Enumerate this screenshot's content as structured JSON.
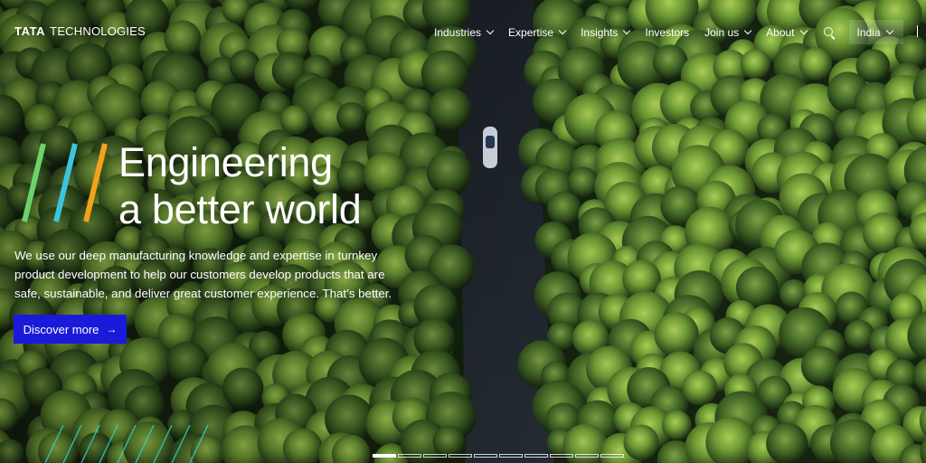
{
  "brand": {
    "name_bold": "TATA",
    "name_rest": "TECHNOLOGIES"
  },
  "nav": {
    "items": [
      {
        "label": "Industries",
        "has_dropdown": true
      },
      {
        "label": "Expertise",
        "has_dropdown": true
      },
      {
        "label": "Insights",
        "has_dropdown": true
      },
      {
        "label": "Investors",
        "has_dropdown": false
      },
      {
        "label": "Join us",
        "has_dropdown": true
      },
      {
        "label": "About",
        "has_dropdown": true
      }
    ],
    "search_icon": "search-icon",
    "country": "India"
  },
  "hero": {
    "headline_line1": "Engineering",
    "headline_line2": "a better world",
    "description": "We use our deep manufacturing knowledge and expertise in turnkey product development to help our customers develop products that are safe, sustainable, and deliver great customer experience. That’s better.",
    "cta_label": "Discover more",
    "cta_arrow": "→"
  },
  "carousel": {
    "slide_count": 10,
    "active_index": 0
  },
  "colors": {
    "cta": "#1a1bd8",
    "stripe_green": "#6bd36b",
    "stripe_cyan": "#39c6dc",
    "stripe_orange": "#f4a21c",
    "deco_line": "#2fd0c0"
  }
}
